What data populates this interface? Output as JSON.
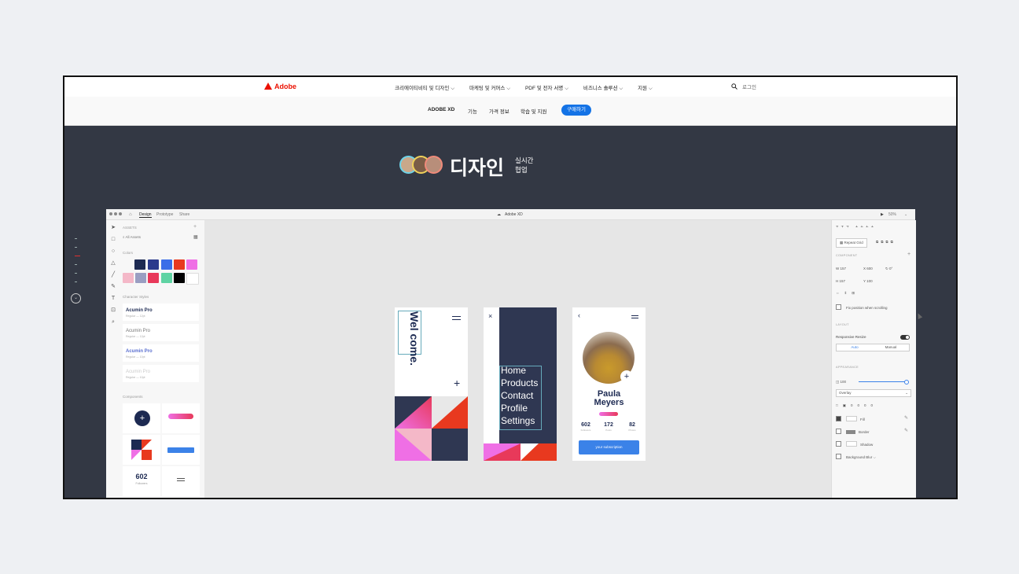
{
  "global_nav": {
    "brand": "Adobe",
    "menu": [
      "크리에이티비티 및 디자인 ⌵",
      "마케팅 및 커머스 ⌵",
      "PDF 및 전자 서명 ⌵",
      "비즈니스 솔루션 ⌵",
      "지원 ⌵"
    ],
    "login": "로그인"
  },
  "sub_nav": {
    "product": "ADOBE XD",
    "items": [
      "기능",
      "가격 정보",
      "학습 및 지원"
    ],
    "buy": "구매하기"
  },
  "hero": {
    "title": "디자인",
    "subtitle_line1": "실시간",
    "subtitle_line2": "협업"
  },
  "xd": {
    "tabs": [
      "Design",
      "Prototype",
      "Share"
    ],
    "title": "Adobe XD",
    "zoom": "50%",
    "assets": {
      "header": "ASSETS",
      "filter": "All Assets",
      "colors_label": "Colors",
      "char_styles_label": "Character Styles",
      "components_label": "Components",
      "colors_row1": [
        "#1d2a52",
        "#2b3a8c",
        "#3b6ee8",
        "#e8391f",
        "#ef6fe5"
      ],
      "colors_row2": [
        "#f4b8c8",
        "#9a9ec2",
        "#e8395a",
        "#5fd3a3",
        "#000000",
        "#ffffff"
      ],
      "char_styles": [
        {
          "name": "Acumin Pro",
          "meta": "Regular — 12pt"
        },
        {
          "name": "Acumin Pro",
          "meta": "Regular — 12pt"
        },
        {
          "name": "Acumin Pro",
          "meta": "Regular — 10pt"
        },
        {
          "name": "Acumin Pro",
          "meta": "Regular — 10pt"
        }
      ],
      "comp_stat": "602",
      "comp_stat_label": "Followers"
    },
    "artboards": {
      "welcome": "Wel come.",
      "menu_items": [
        "Home",
        "Products",
        "Contact",
        "Profile",
        "Settings"
      ],
      "profile_name_1": "Paula",
      "profile_name_2": "Meyers",
      "stats": [
        {
          "value": "602",
          "label": "Followers"
        },
        {
          "value": "172",
          "label": "Posts"
        },
        {
          "value": "82",
          "label": "Photos"
        }
      ],
      "cta": "your subscription"
    },
    "props": {
      "repeat_grid": "Repeat Grid",
      "component": "COMPONENT",
      "w": "157",
      "h": "157",
      "x": "600",
      "y": "100",
      "rotation": "0°",
      "fix_position": "Fix position when scrolling",
      "layout": "LAYOUT",
      "responsive_resize": "Responsive Resize",
      "auto": "Auto",
      "manual": "Manual",
      "appearance": "APPEARANCE",
      "opacity": "100",
      "blend": "Overlay",
      "radius_values": [
        "0",
        "0",
        "0",
        "0"
      ],
      "fill": "Fill",
      "border": "Border",
      "shadow": "Shadow",
      "background_blur": "Background Blur ⌵"
    }
  }
}
